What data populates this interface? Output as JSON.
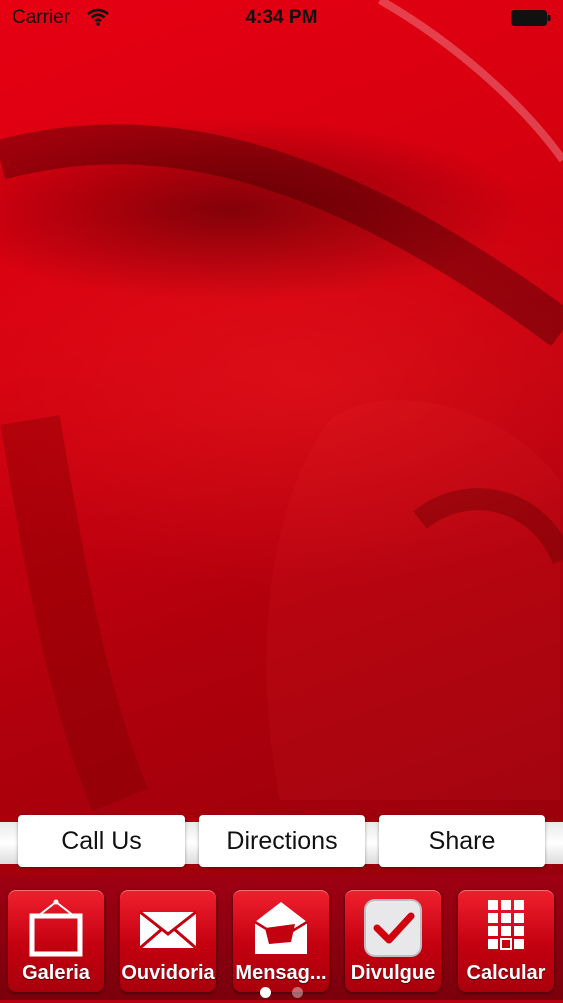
{
  "status_bar": {
    "carrier": "Carrier",
    "time": "4:34 PM"
  },
  "actions": {
    "call_label": "Call Us",
    "directions_label": "Directions",
    "share_label": "Share"
  },
  "tabs": [
    {
      "label": "Galeria",
      "icon": "picture-frame-icon"
    },
    {
      "label": "Ouvidoria",
      "icon": "envelope-icon"
    },
    {
      "label": "Mensag...",
      "icon": "open-envelope-icon"
    },
    {
      "label": "Divulgue",
      "icon": "checkmark-icon"
    },
    {
      "label": "Calcular",
      "icon": "calculator-icon"
    }
  ],
  "pagination": {
    "total_pages": 2,
    "current_page": 1
  },
  "colors": {
    "background": "#d4000f",
    "tab_bar": "#8e000a",
    "button_bg": "#ffffff"
  }
}
